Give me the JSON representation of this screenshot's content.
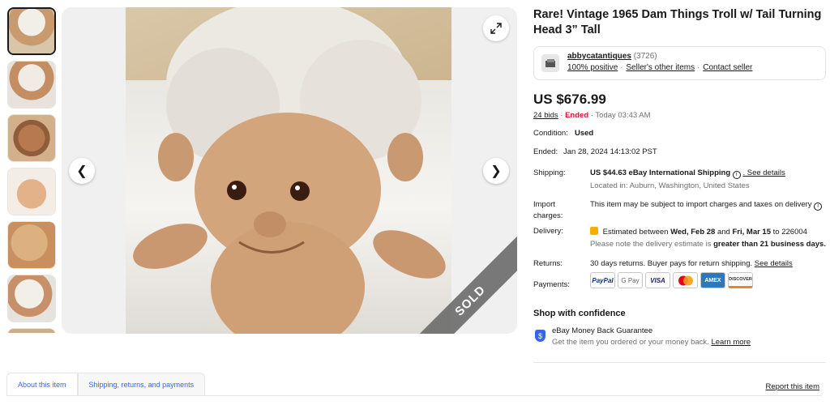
{
  "listing": {
    "title": "Rare! Vintage 1965 Dam Things Troll w/ Tail Turning Head 3” Tall",
    "image_overlay": "SOLD"
  },
  "seller": {
    "name": "abbycatantiques",
    "feedback_count": "(3726)",
    "positive": "100% positive",
    "other_items": "Seller's other items",
    "contact": "Contact seller"
  },
  "pricing": {
    "price": "US $676.99",
    "bids": "24 bids",
    "status": "Ended",
    "time": "Today 03:43 AM"
  },
  "details": {
    "condition_label": "Condition:",
    "condition_value": "Used",
    "ended_label": "Ended:",
    "ended_value": "Jan 28, 2024 14:13:02 PST",
    "shipping_label": "Shipping:",
    "shipping_value": "US $44.63 eBay International Shipping",
    "shipping_link": ". See details",
    "located": "Located in: Auburn, Washington, United States",
    "import_label_1": "Import",
    "import_label_2": "charges:",
    "import_value": "This item may be subject to import charges and taxes on delivery",
    "delivery_label": "Delivery:",
    "delivery_pre": "Estimated between",
    "delivery_from": "Wed, Feb 28",
    "delivery_and": "and",
    "delivery_to": "Fri, Mar 15",
    "delivery_zip": "to 226004",
    "delivery_note_pre": "Please note the delivery estimate is",
    "delivery_note_bold": "greater than 21 business days.",
    "returns_label": "Returns:",
    "returns_value": "30 days returns. Buyer pays for return shipping.",
    "returns_link": "See details",
    "payments_label": "Payments:"
  },
  "payments": {
    "paypal": "PayPal",
    "gpay": "G Pay",
    "visa": "VISA",
    "amex": "AMEX",
    "discover": "DISCOVER"
  },
  "confidence": {
    "heading": "Shop with confidence",
    "guarantee_title": "eBay Money Back Guarantee",
    "guarantee_sub": "Get the item you ordered or your money back.",
    "learn_more": "Learn more"
  },
  "tabs": {
    "about": "About this item",
    "shipping": "Shipping, returns, and payments"
  },
  "report": "Report this item",
  "colors": {
    "accent": "#3665f3",
    "ended": "#e0103a",
    "text": "#191919",
    "muted": "#707070"
  }
}
